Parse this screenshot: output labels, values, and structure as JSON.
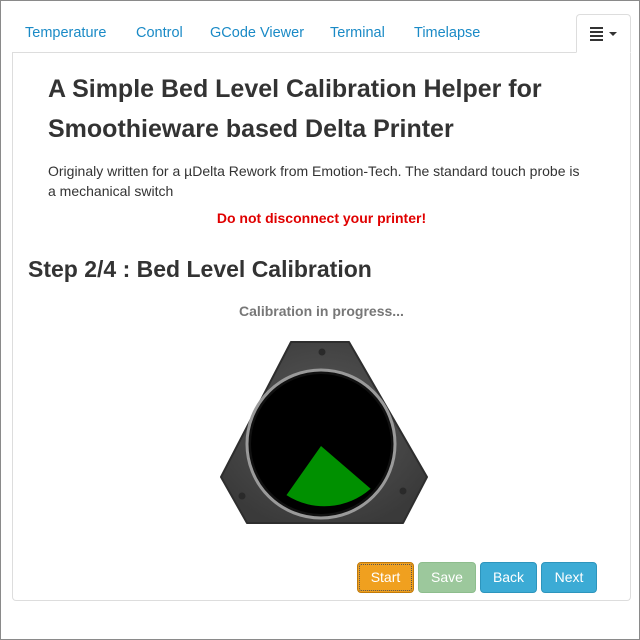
{
  "tabs": [
    {
      "label": "Temperature"
    },
    {
      "label": "Control"
    },
    {
      "label": "GCode Viewer"
    },
    {
      "label": "Terminal"
    },
    {
      "label": "Timelapse"
    }
  ],
  "menu_icon": "hamburger-menu-icon",
  "content": {
    "title_line1": "A Simple Bed Level Calibration Helper for",
    "title_line2": "Smoothieware based Delta Printer",
    "description_line1": "Originaly written for a µDelta Rework from Emotion-Tech. The standard touch probe is",
    "description_line2": "a mechanical switch",
    "warning": "Do not disconnect your printer!",
    "step_title": "Step 2/4 : Bed Level Calibration",
    "progress_text": "Calibration in progress..."
  },
  "buttons": {
    "start": "Start",
    "save": "Save",
    "back": "Back",
    "next": "Next"
  },
  "colors": {
    "tab_link": "#1a8ac6",
    "warning": "#e00000",
    "start_button": "#f0a01f",
    "save_button_disabled": "#9cc89c",
    "back_next_button": "#3cabd5",
    "progress_sector": "#009000"
  }
}
